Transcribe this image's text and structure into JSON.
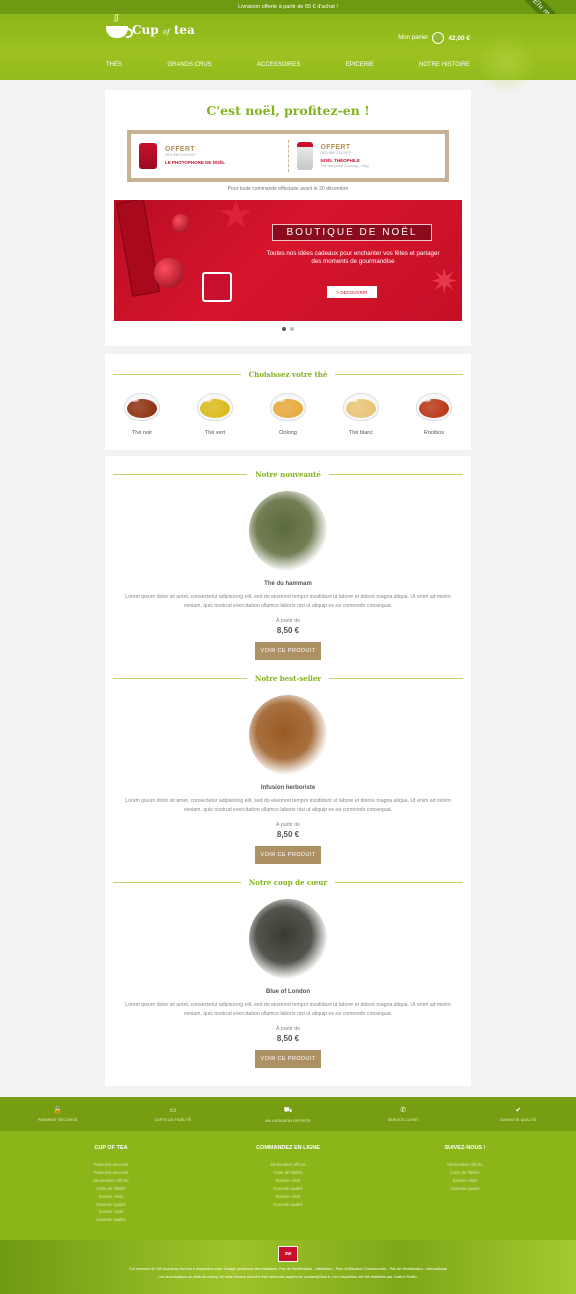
{
  "topbar": {
    "message": "Livraison offerte à partir de 65 € d'achat !"
  },
  "ribbon": {
    "text": "Élu meilleur thé"
  },
  "header": {
    "logo_main": "Cup",
    "logo_of": "of",
    "logo_tea": "tea",
    "cart_label": "Mon panier",
    "cart_total": "42,00 €",
    "nav": [
      "THÉS",
      "GRANDS CRUS",
      "ACCESSOIRES",
      "EPICERIE",
      "NOTRE HISTOIRE"
    ]
  },
  "xmas": {
    "title": "C'est noël, profitez-en !",
    "offers": [
      {
        "offered": "OFFERT",
        "condition": "DÈS 65€ D'ACHAT*",
        "name": "LE PHOTOPHORE DE NOËL",
        "detail": ""
      },
      {
        "offered": "OFFERT",
        "condition": "DÈS 85€ D'ACHAT*",
        "name": "NOËL THÉOPHILE",
        "detail": "Thé vert pruné & cocnig - 100g"
      }
    ],
    "note": "Pour toute commande effectuée avant le 20 décembre",
    "hero_title": "BOUTIQUE DE NOËL",
    "hero_tagline": "Toutes nos idées cadeaux pour enchanter vos fêtes et partager des moments de gourmandise",
    "hero_button": "> DECOUVRIR"
  },
  "teas": {
    "title": "Choisissez votre thé",
    "items": [
      {
        "label": "Thé noir",
        "color": "#8a2a08"
      },
      {
        "label": "Thé vert",
        "color": "#d9b814"
      },
      {
        "label": "Oolong",
        "color": "#e6a636"
      },
      {
        "label": "Thé blanc",
        "color": "#e8c272"
      },
      {
        "label": "Rooibos",
        "color": "#b8300e"
      }
    ]
  },
  "products": [
    {
      "section": "Notre nouveauté",
      "name": "Thé du hammam",
      "desc": "Lorem ipsum dolor sit amet, consectetur adipisicing elit, sed do eiusmod tempor incididunt ut labore et dolore magna aliqua. Ut enim ad minim veniam, quis nostrud exercitation ullamco laboris nisi ut aliquip ex ea commodo consequat.",
      "from": "À partir de",
      "price": "8,50 €",
      "button": "VOIR CE PRODUIT",
      "tone": "#5c6b3a"
    },
    {
      "section": "Notre best-seller",
      "name": "Infusion herboriste",
      "desc": "Lorem ipsum dolor sit amet, consectetur adipisicing elit, sed do eiusmod tempor incididunt ut labore et dolore magna aliqua. Ut enim ad minim veniam, quis nostrud exercitation ullamco laboris nisi ut aliquip ex ea commodo consequat.",
      "from": "À partir de",
      "price": "8,50 €",
      "button": "VOIR CE PRODUIT",
      "tone": "#9a5a22"
    },
    {
      "section": "Notre coup de cœur",
      "name": "Blue of London",
      "desc": "Lorem ipsum dolor sit amet, consectetur adipisicing elit, sed do eiusmod tempor incididunt ut labore et dolore magna aliqua. Ut enim ad minim veniam, quis nostrud exercitation ullamco laboris nisi ut aliquip ex ea commodo consequat.",
      "from": "À partir de",
      "price": "8,50 €",
      "button": "VOIR CE PRODUIT",
      "tone": "#3a3a32"
    }
  ],
  "reassurance": [
    {
      "icon": "lock-icon",
      "glyph": "🔒",
      "label": "PAIEMENT SÉCURISÉ"
    },
    {
      "icon": "card-icon",
      "glyph": "▭",
      "label": "CARTE DE FIDÉLITÉ"
    },
    {
      "icon": "truck-icon",
      "glyph": "⛟",
      "label": "MA LIVRAISON OFFERTE"
    },
    {
      "icon": "phone-icon",
      "glyph": "✆",
      "label": "SERVICE CLIENT"
    },
    {
      "icon": "check-icon",
      "glyph": "✔",
      "label": "GARANTIE QUALITÉ"
    }
  ],
  "footer": {
    "columns": [
      {
        "title": "CUP OF TEA",
        "links": [
          "Paiement sécurisé",
          "Paiement sécurisé",
          "Ma livraison offerte",
          "Carte de fidélité",
          "Service client",
          "Garantie qualité",
          "Service client",
          "Garantie qualité"
        ]
      },
      {
        "title": "COMMANDEZ EN LIGNE",
        "links": [
          "Ma livraison offerte",
          "Carte de fidélité",
          "Service client",
          "Garantie qualité",
          "Service client",
          "Garantie qualité"
        ]
      },
      {
        "title": "SUIVEZ-NOUS !",
        "links": [
          "Ma livraison offerte",
          "Carte de fidélité",
          "Service client",
          "Garantie qualité"
        ]
      }
    ],
    "badge": "3W",
    "legal_1": "Cet exercice de 3W Academy est mis à disposition pour l'usage personnel des étudiants. Pas de Modification - Attribution - Pas d'Utilisation Commerciale - Pas de Modification - International",
    "legal_2": "Les autorisations au-delà du champ de cette licence peuvent être obtenues auprès de contact@3wa.fr. Les maquettes ont été réalisées par Justine Muller."
  }
}
